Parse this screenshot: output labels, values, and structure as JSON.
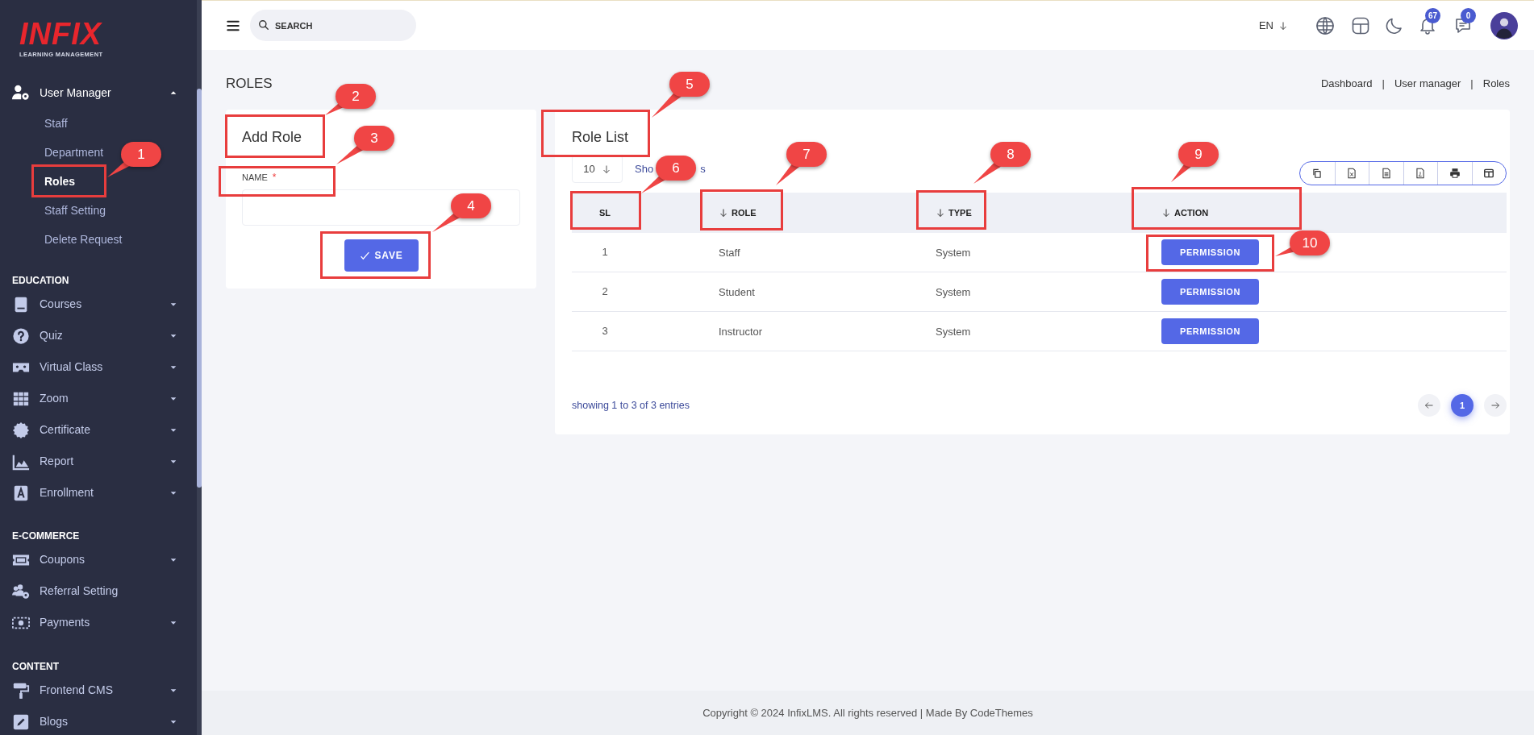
{
  "sidebar": {
    "logo": {
      "wordmark": "INFIX",
      "tagline": "LEARNING MANAGEMENT"
    },
    "groups": [
      {
        "items": [
          {
            "label": "User Manager",
            "has_submenu": true,
            "expanded": true,
            "children": [
              {
                "label": "Staff",
                "selected": false
              },
              {
                "label": "Department",
                "selected": false
              },
              {
                "label": "Roles",
                "selected": true
              },
              {
                "label": "Staff Setting",
                "selected": false
              },
              {
                "label": "Delete Request",
                "selected": false
              }
            ]
          }
        ]
      },
      {
        "heading": "EDUCATION",
        "items": [
          {
            "label": "Courses",
            "has_submenu": true,
            "expanded": false
          },
          {
            "label": "Quiz",
            "has_submenu": true,
            "expanded": false
          },
          {
            "label": "Virtual Class",
            "has_submenu": true,
            "expanded": false
          },
          {
            "label": "Zoom",
            "has_submenu": true,
            "expanded": false
          },
          {
            "label": "Certificate",
            "has_submenu": true,
            "expanded": false
          },
          {
            "label": "Report",
            "has_submenu": true,
            "expanded": false
          },
          {
            "label": "Enrollment",
            "has_submenu": true,
            "expanded": false
          }
        ]
      },
      {
        "heading": "E-COMMERCE",
        "items": [
          {
            "label": "Coupons",
            "has_submenu": true,
            "expanded": false
          },
          {
            "label": "Referral Setting",
            "has_submenu": false,
            "expanded": false
          },
          {
            "label": "Payments",
            "has_submenu": true,
            "expanded": false
          }
        ]
      },
      {
        "heading": "CONTENT",
        "items": [
          {
            "label": "Frontend CMS",
            "has_submenu": true,
            "expanded": false
          },
          {
            "label": "Blogs",
            "has_submenu": true,
            "expanded": false
          }
        ]
      }
    ]
  },
  "header": {
    "search": {
      "placeholder": "SEARCH"
    },
    "language": "EN",
    "notifications_badge": "67",
    "messages_badge": "0"
  },
  "page": {
    "title": "ROLES",
    "breadcrumb": [
      {
        "kind": "link",
        "text": "Dashboard"
      },
      {
        "kind": "separator",
        "text": "|"
      },
      {
        "kind": "link",
        "text": "User manager"
      },
      {
        "kind": "separator",
        "text": "|"
      },
      {
        "kind": "current",
        "text": "Roles"
      }
    ]
  },
  "add_role": {
    "title": "Add Role",
    "field": {
      "label": "NAME",
      "required": true,
      "required_mark": "*"
    },
    "save_button": "SAVE"
  },
  "role_list": {
    "title": "Role List",
    "page_length": "10",
    "length_hint_parts": [
      "Sho",
      "s"
    ],
    "columns": [
      {
        "label": "SL",
        "sortable": false
      },
      {
        "label": "ROLE",
        "sortable": true
      },
      {
        "label": "TYPE",
        "sortable": true
      },
      {
        "label": "ACTION",
        "sortable": true
      }
    ],
    "rows": [
      {
        "sl": "1",
        "role": "Staff",
        "type": "System",
        "action": "PERMISSION"
      },
      {
        "sl": "2",
        "role": "Student",
        "type": "System",
        "action": "PERMISSION"
      },
      {
        "sl": "3",
        "role": "Instructor",
        "type": "System",
        "action": "PERMISSION"
      }
    ],
    "info": "showing 1 to 3 of 3 entries",
    "pages": [
      {
        "label": "1",
        "selected": true
      }
    ]
  },
  "footer": {
    "copyright": "Copyright © 2024 InfixLMS. All rights reserved | Made By CodeThemes"
  },
  "callouts": [
    {
      "label": "1"
    },
    {
      "label": "2"
    },
    {
      "label": "3"
    },
    {
      "label": "4"
    },
    {
      "label": "5"
    },
    {
      "label": "6"
    },
    {
      "label": "7"
    },
    {
      "label": "8"
    },
    {
      "label": "9"
    },
    {
      "label": "10"
    }
  ]
}
